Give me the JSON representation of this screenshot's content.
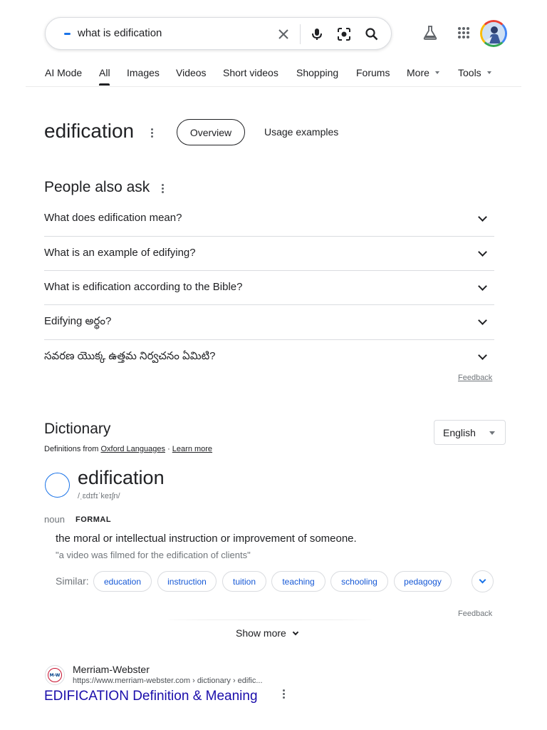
{
  "search": {
    "query": "what is edification"
  },
  "tabs": [
    {
      "label": "AI Mode"
    },
    {
      "label": "All"
    },
    {
      "label": "Images"
    },
    {
      "label": "Videos"
    },
    {
      "label": "Short videos"
    },
    {
      "label": "Shopping"
    },
    {
      "label": "Forums"
    },
    {
      "label": "More"
    },
    {
      "label": "Tools"
    }
  ],
  "overview": {
    "title": "edification",
    "chip_overview": "Overview",
    "chip_usage": "Usage examples"
  },
  "paa": {
    "title": "People also ask",
    "questions": [
      "What does edification mean?",
      "What is an example of edifying?",
      "What is edification according to the Bible?",
      "Edifying అర్థం?",
      "సవరణ యొక్క ఉత్తమ నిర్వచనం ఏమిటి?"
    ],
    "feedback": "Feedback"
  },
  "dictionary": {
    "title": "Dictionary",
    "source_prefix": "Definitions from",
    "source_link": "Oxford Languages",
    "separator": "·",
    "learn_more": "Learn more",
    "language": "English",
    "word": "edification",
    "phonetic": "/ˌɛdɪfɪˈkeɪʃn/",
    "part_of_speech": "noun",
    "register": "FORMAL",
    "definition": "the moral or intellectual instruction or improvement of someone.",
    "example": "\"a video was filmed for the edification of clients\"",
    "similar_label": "Similar:",
    "similar": [
      "education",
      "instruction",
      "tuition",
      "teaching",
      "schooling",
      "pedagogy"
    ],
    "feedback": "Feedback",
    "show_more": "Show more"
  },
  "result": {
    "site_name": "Merriam-Webster",
    "url": "https://www.merriam-webster.com › dictionary › edific...",
    "favicon_text": "M-W",
    "title": "EDIFICATION Definition & Meaning"
  },
  "colors": {
    "link": "#1a0dab",
    "accent": "#1a73e8"
  }
}
